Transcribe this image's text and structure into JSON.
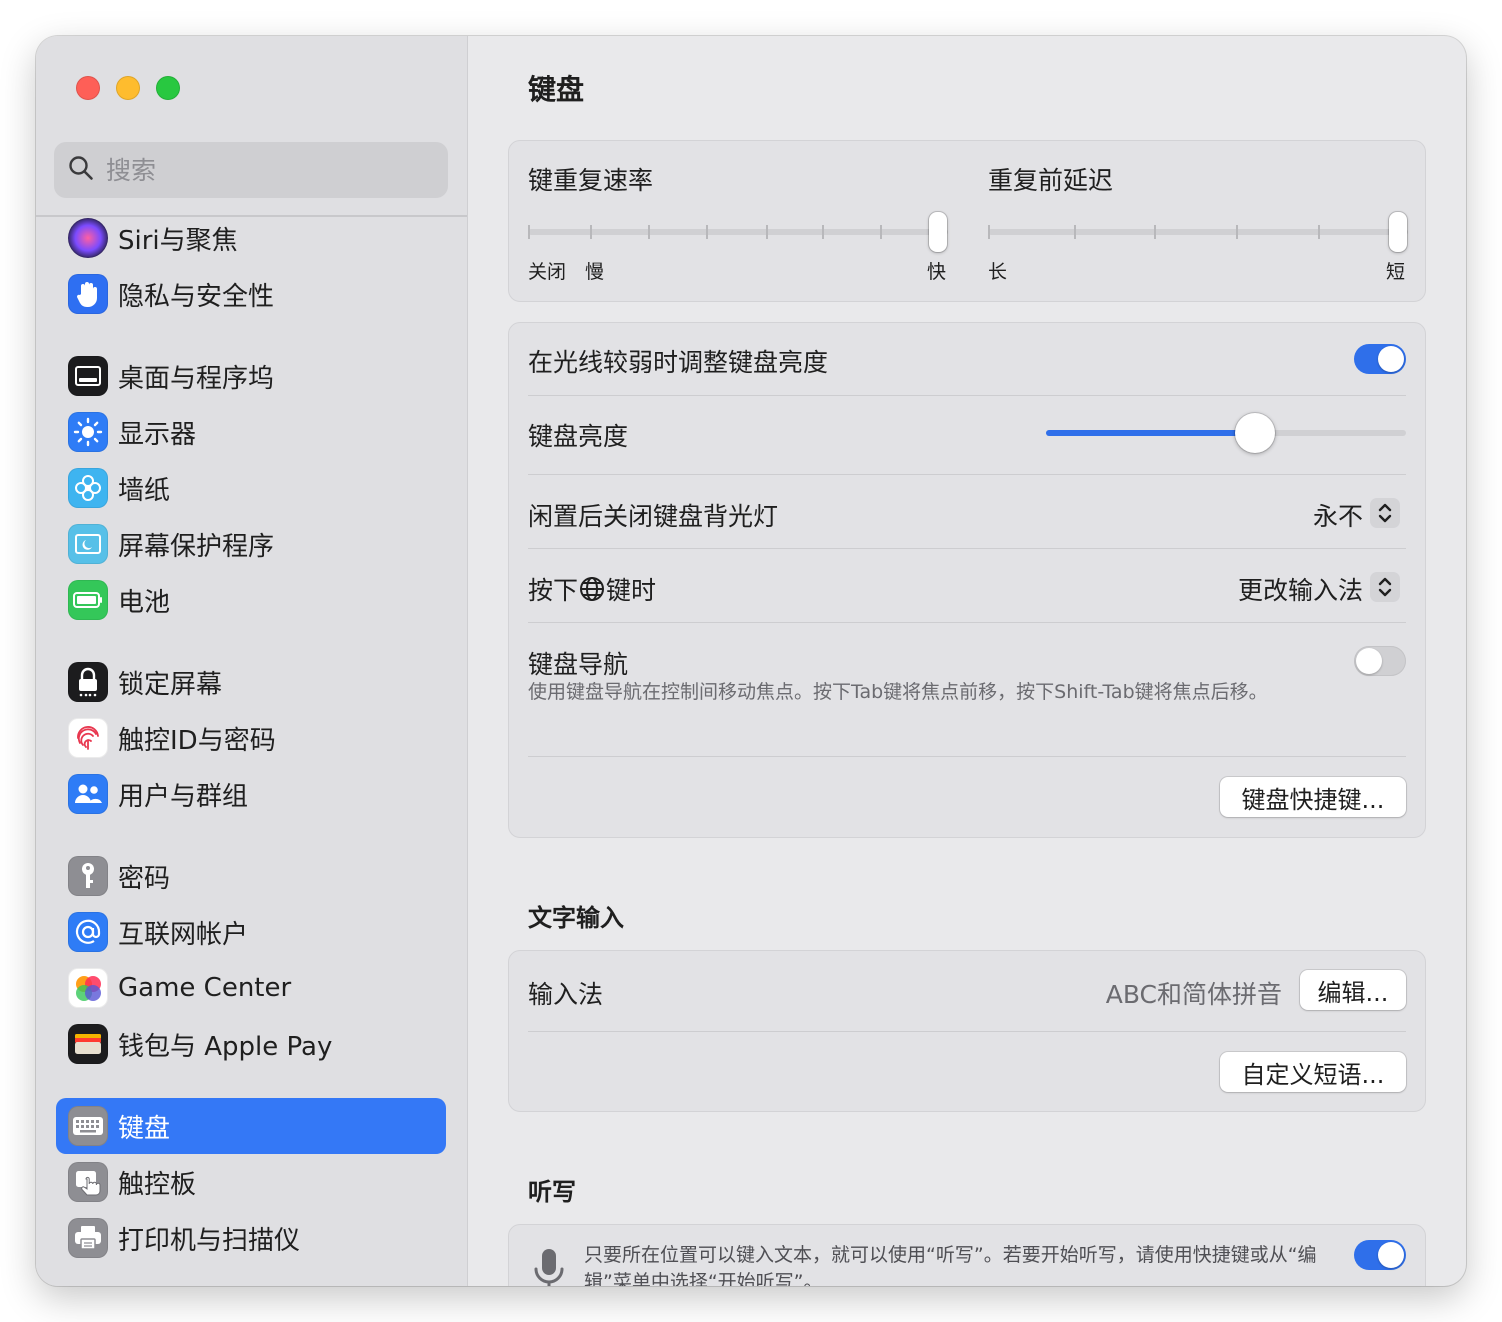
{
  "window": {
    "traffic_lights": [
      "close",
      "minimize",
      "maximize"
    ]
  },
  "search": {
    "placeholder": "搜索"
  },
  "sidebar": {
    "items": [
      {
        "label": "Siri与聚焦",
        "icon": "siri-icon",
        "color": "#5b3fd6"
      },
      {
        "label": "隐私与安全性",
        "icon": "hand-icon",
        "color": "#2e6ff2"
      },
      {
        "label": "桌面与程序坞",
        "icon": "dock-icon",
        "color": "#1c1c1e"
      },
      {
        "label": "显示器",
        "icon": "sun-icon",
        "color": "#2e7cf6"
      },
      {
        "label": "墙纸",
        "icon": "flower-icon",
        "color": "#3eb4f0"
      },
      {
        "label": "屏幕保护程序",
        "icon": "screensaver-icon",
        "color": "#57c0e8"
      },
      {
        "label": "电池",
        "icon": "battery-icon",
        "color": "#34c759"
      },
      {
        "label": "锁定屏幕",
        "icon": "lock-icon",
        "color": "#1c1c1e"
      },
      {
        "label": "触控ID与密码",
        "icon": "fingerprint-icon",
        "color": "#ffffff"
      },
      {
        "label": "用户与群组",
        "icon": "users-icon",
        "color": "#2e7cf6"
      },
      {
        "label": "密码",
        "icon": "key-icon",
        "color": "#8e8e93"
      },
      {
        "label": "互联网帐户",
        "icon": "at-icon",
        "color": "#2e7cf6"
      },
      {
        "label": "Game Center",
        "icon": "game-center-icon",
        "color": "#ffffff"
      },
      {
        "label": "钱包与 Apple Pay",
        "icon": "wallet-icon",
        "color": "#1c1c1e"
      },
      {
        "label": "键盘",
        "icon": "keyboard-icon",
        "color": "#8e8e93",
        "selected": true
      },
      {
        "label": "触控板",
        "icon": "trackpad-icon",
        "color": "#8e8e93"
      },
      {
        "label": "打印机与扫描仪",
        "icon": "printer-icon",
        "color": "#8e8e93"
      }
    ]
  },
  "main": {
    "title": "键盘",
    "repeat": {
      "rate_label": "键重复速率",
      "rate_ticks": [
        "关闭",
        "慢",
        "快"
      ],
      "rate_value_fraction": 1.0,
      "delay_label": "重复前延迟",
      "delay_ticks": [
        "长",
        "短"
      ],
      "delay_value_fraction": 1.0
    },
    "backlight": {
      "auto_label": "在光线较弱时调整键盘亮度",
      "auto_on": true,
      "brightness_label": "键盘亮度",
      "brightness_fraction": 0.58,
      "idle_label": "闲置后关闭键盘背光灯",
      "idle_value": "永不",
      "globe_prefix": "按下",
      "globe_suffix": "键时",
      "globe_value": "更改输入法",
      "nav_label": "键盘导航",
      "nav_desc": "使用键盘导航在控制间移动焦点。按下Tab键将焦点前移，按下Shift-Tab键将焦点后移。",
      "nav_on": false,
      "shortcuts_button": "键盘快捷键..."
    },
    "text_input": {
      "section_title": "文字输入",
      "input_label": "输入法",
      "input_value": "ABC和简体拼音",
      "edit_button": "编辑...",
      "replacements_button": "自定义短语..."
    },
    "dictation": {
      "section_title": "听写",
      "desc": "只要所在位置可以键入文本，就可以使用“听写”。若要开始听写，请使用快捷键或从“编辑”菜单中选择“开始听写”。",
      "on": true
    }
  },
  "colors": {
    "accent": "#3478f6",
    "toggle_on": "#2f6fea"
  }
}
